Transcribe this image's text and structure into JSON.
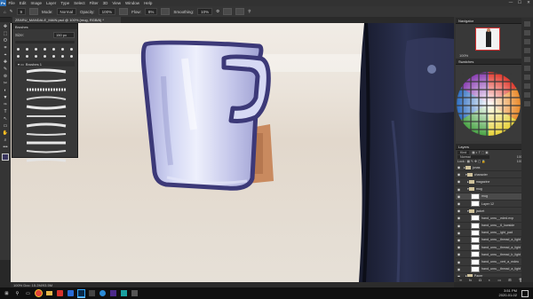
{
  "menu": {
    "logo": "Ps",
    "items": [
      "File",
      "Edit",
      "Image",
      "Layer",
      "Type",
      "Select",
      "Filter",
      "3D",
      "View",
      "Window",
      "Help"
    ]
  },
  "window_controls": [
    "—",
    "☐",
    "✕"
  ],
  "options": {
    "size": "9",
    "mode_label": "Mode:",
    "mode_value": "Normal",
    "opacity_label": "Opacity:",
    "opacity_value": "100%",
    "flow_label": "Flow:",
    "flow_value": "8%",
    "smoothing_label": "Smoothing:",
    "smoothing_value": "10%"
  },
  "document": {
    "tab_title": "ZEARU_MANDALE_MAIN.psd @ 100% (mug, RGB/8) *",
    "status": "100%   Doc: 15.2M/93.5M"
  },
  "tools": [
    "✥",
    "⬚",
    "ʘ",
    "⌗",
    "⌖",
    "✚",
    "✎",
    "⊚",
    "✂",
    "◐",
    "▼",
    "✑",
    "T",
    "↖",
    "▭",
    "✋",
    "⌕",
    "•••"
  ],
  "brush_panel": {
    "title": "Brushes",
    "size_label": "Size:",
    "size_value": "150 px",
    "folder_label": "Brushes 1"
  },
  "navigator": {
    "title": "Navigator",
    "zoom": "100%"
  },
  "swatches": {
    "title": "Swatches"
  },
  "layers": {
    "title": "Layers",
    "kind": "Kind",
    "blend": "Normal",
    "opacity": "100%",
    "lock_label": "Lock:",
    "fill": "100%",
    "rows": [
      {
        "name": "jonas",
        "type": "folder",
        "indent": 1
      },
      {
        "name": "character",
        "type": "folder",
        "indent": 2
      },
      {
        "name": "magazine",
        "type": "folder",
        "indent": 3
      },
      {
        "name": "mug",
        "type": "folder",
        "indent": 3
      },
      {
        "name": "mug",
        "type": "layer",
        "indent": 4,
        "selected": true
      },
      {
        "name": "Layer 12",
        "type": "layer",
        "indent": 4
      },
      {
        "name": "jacket",
        "type": "folder",
        "indent": 3
      },
      {
        "name": "hand_unru__eded.exp",
        "type": "layer",
        "indent": 4
      },
      {
        "name": "hand_unru__6_lowside",
        "type": "layer",
        "indent": 4
      },
      {
        "name": "hand_unru__ight_pad",
        "type": "layer",
        "indent": 4
      },
      {
        "name": "hand_unru__thread_a_light",
        "type": "layer",
        "indent": 4
      },
      {
        "name": "hand_unru__thread_a_light",
        "type": "layer",
        "indent": 4
      },
      {
        "name": "hand_unru__thread_b_light",
        "type": "layer",
        "indent": 4
      },
      {
        "name": "hand_unru__vert_a_mdeu",
        "type": "layer",
        "indent": 4
      },
      {
        "name": "hand_unru__thread_a_light",
        "type": "layer",
        "indent": 4
      },
      {
        "name": "Paper",
        "type": "folder",
        "indent": 2
      }
    ]
  },
  "taskbar": {
    "time": "3:51 PM",
    "date": "2020-01-02"
  },
  "colors": {
    "canvas_bg": "#e9e2d8",
    "mug_body": "#b7b9e2",
    "mug_outline": "#3d3a78",
    "jacket": "#1d2138"
  }
}
